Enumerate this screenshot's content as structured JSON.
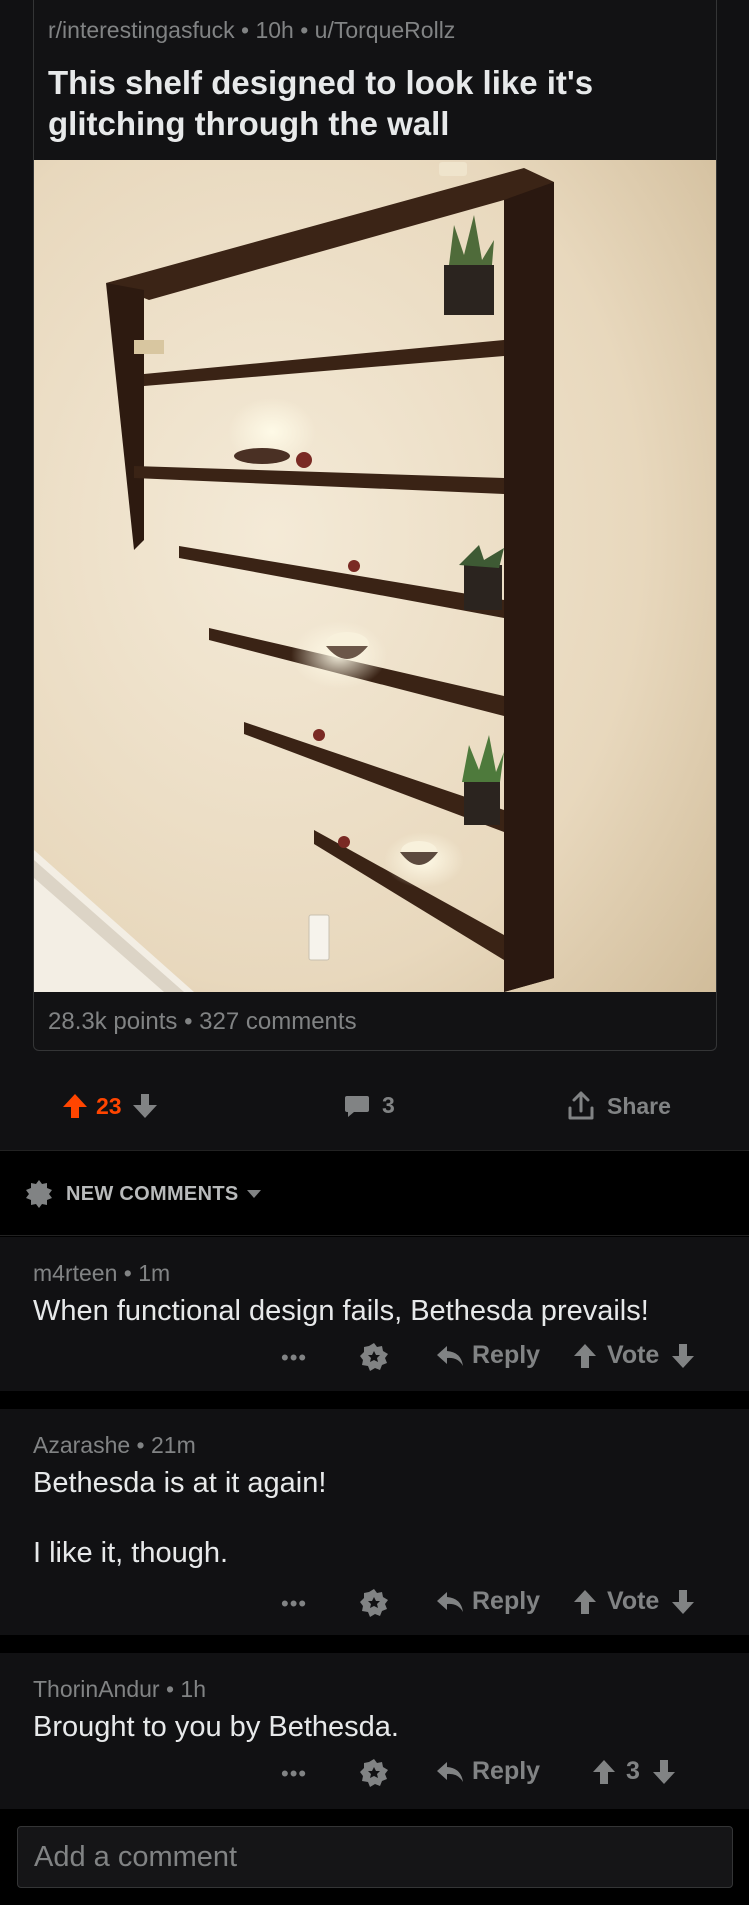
{
  "post": {
    "meta": "r/interestingasfuck • 10h • u/TorqueRollz",
    "title": "This shelf designed to look like it's glitching through the wall",
    "stats": "28.3k points • 327 comments"
  },
  "actions": {
    "votes": "23",
    "comments": "3",
    "share_label": "Share"
  },
  "sort": {
    "label": "NEW COMMENTS"
  },
  "comments": [
    {
      "meta": "m4rteen • 1m",
      "body": "When functional design fails, Bethesda prevails!",
      "more": "•••",
      "reply": "Reply",
      "vote": "Vote"
    },
    {
      "meta": "Azarashe • 21m",
      "body_line1": "Bethesda is at it again!",
      "body_line2": "I like it, though.",
      "more": "•••",
      "reply": "Reply",
      "vote": "Vote"
    },
    {
      "meta": "ThorinAndur • 1h",
      "body": "Brought to you by Bethesda.",
      "more": "•••",
      "reply": "Reply",
      "vote": "3"
    }
  ],
  "add_comment": {
    "placeholder": "Add a comment"
  },
  "colors": {
    "background": "#000000",
    "surface": "#111113",
    "text": "#e7e9ea",
    "muted": "#818384",
    "upvote": "#ff4500"
  },
  "icons": [
    "upvote-arrow-icon",
    "downvote-arrow-icon",
    "comment-bubble-icon",
    "share-icon",
    "sort-badge-icon",
    "chevron-down-icon",
    "more-dots-icon",
    "award-icon",
    "reply-arrow-icon"
  ]
}
